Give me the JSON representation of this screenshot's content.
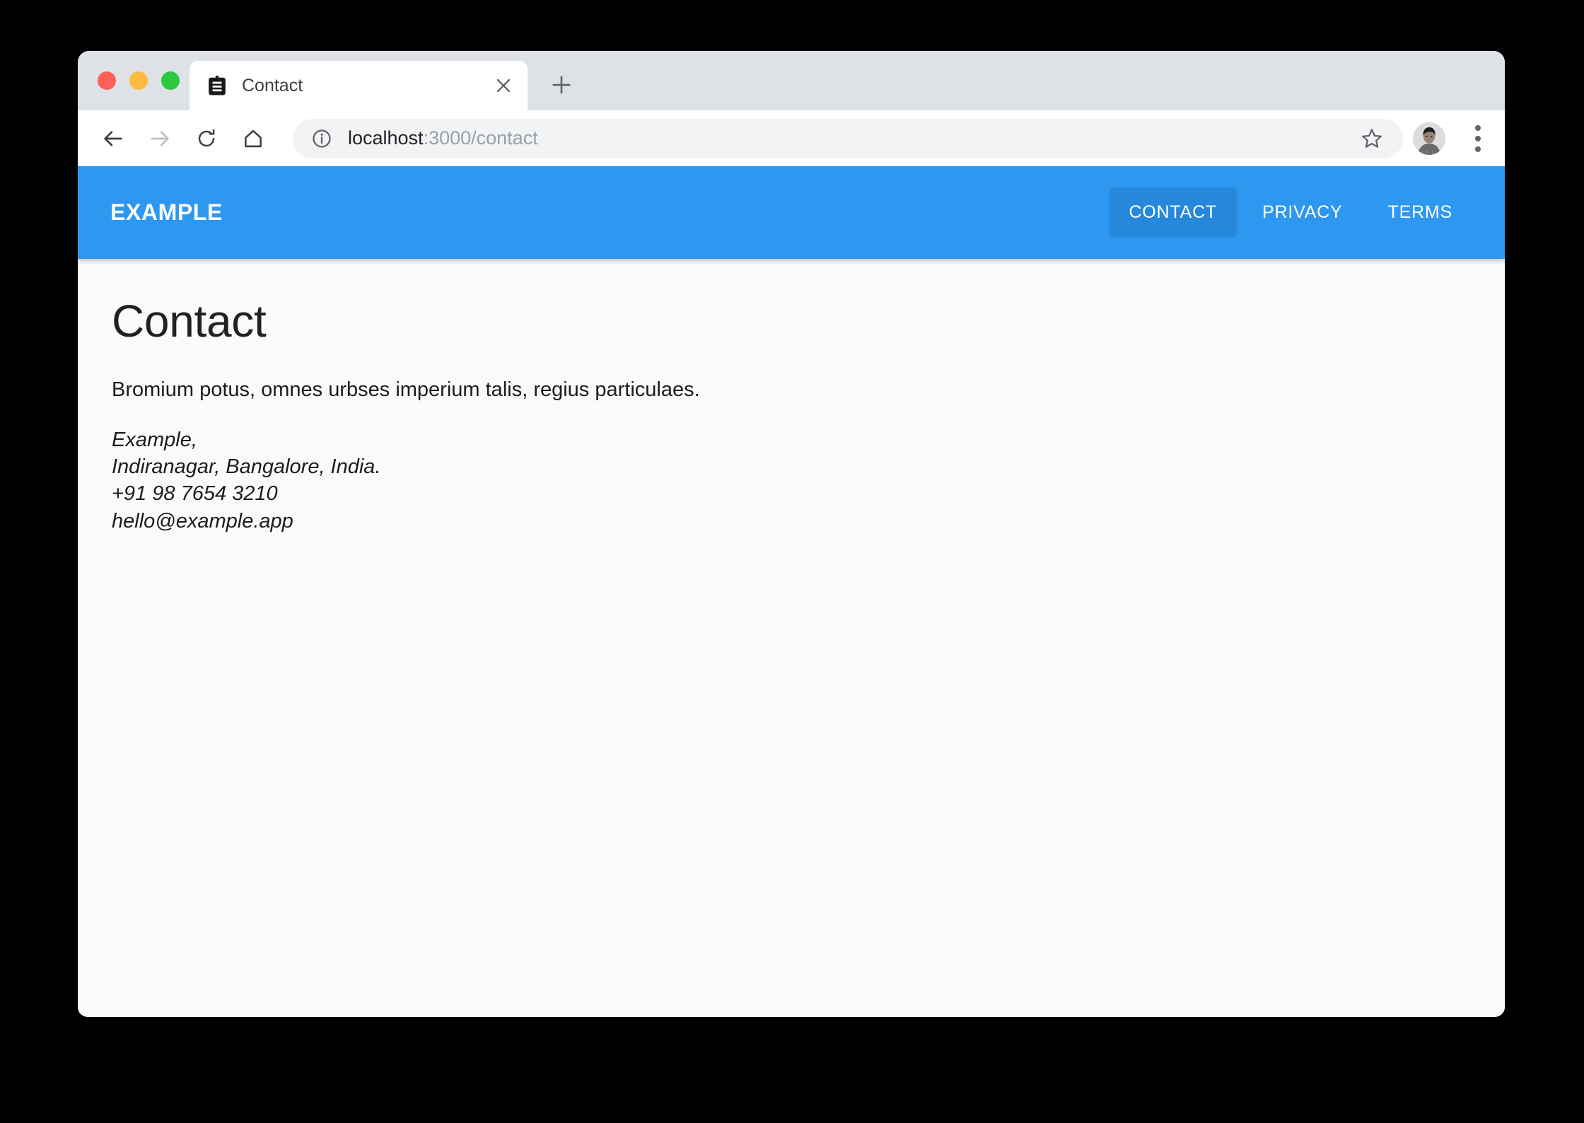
{
  "browser": {
    "traffic_lights": [
      {
        "name": "close",
        "color": "#fc6058"
      },
      {
        "name": "minimize",
        "color": "#fdbc40"
      },
      {
        "name": "maximize",
        "color": "#2ac940"
      }
    ],
    "tab": {
      "title": "Contact",
      "favicon": "clipboard-icon",
      "close_icon": "close-icon"
    },
    "new_tab_icon": "plus-icon",
    "toolbar": {
      "back_icon": "arrow-left-icon",
      "forward_icon": "arrow-right-icon",
      "reload_icon": "reload-icon",
      "home_icon": "home-icon",
      "site_info_icon": "info-circle-icon",
      "url_host": "localhost",
      "url_rest": ":3000/contact",
      "url_full": "localhost:3000/contact",
      "bookmark_icon": "star-icon",
      "avatar_icon": "user-avatar",
      "menu_icon": "three-dots-vertical-icon"
    }
  },
  "site": {
    "brand": "EXAMPLE",
    "accent_color": "#2e97ef",
    "active_link_color": "#2688da",
    "nav_links": [
      {
        "label": "CONTACT",
        "active": true
      },
      {
        "label": "PRIVACY",
        "active": false
      },
      {
        "label": "TERMS",
        "active": false
      }
    ]
  },
  "main": {
    "title": "Contact",
    "intro": "Bromium potus, omnes urbses imperium talis, regius particulaes.",
    "address_lines": [
      "Example,",
      "Indiranagar, Bangalore, India.",
      "+91 98 7654 3210",
      "hello@example.app"
    ]
  }
}
